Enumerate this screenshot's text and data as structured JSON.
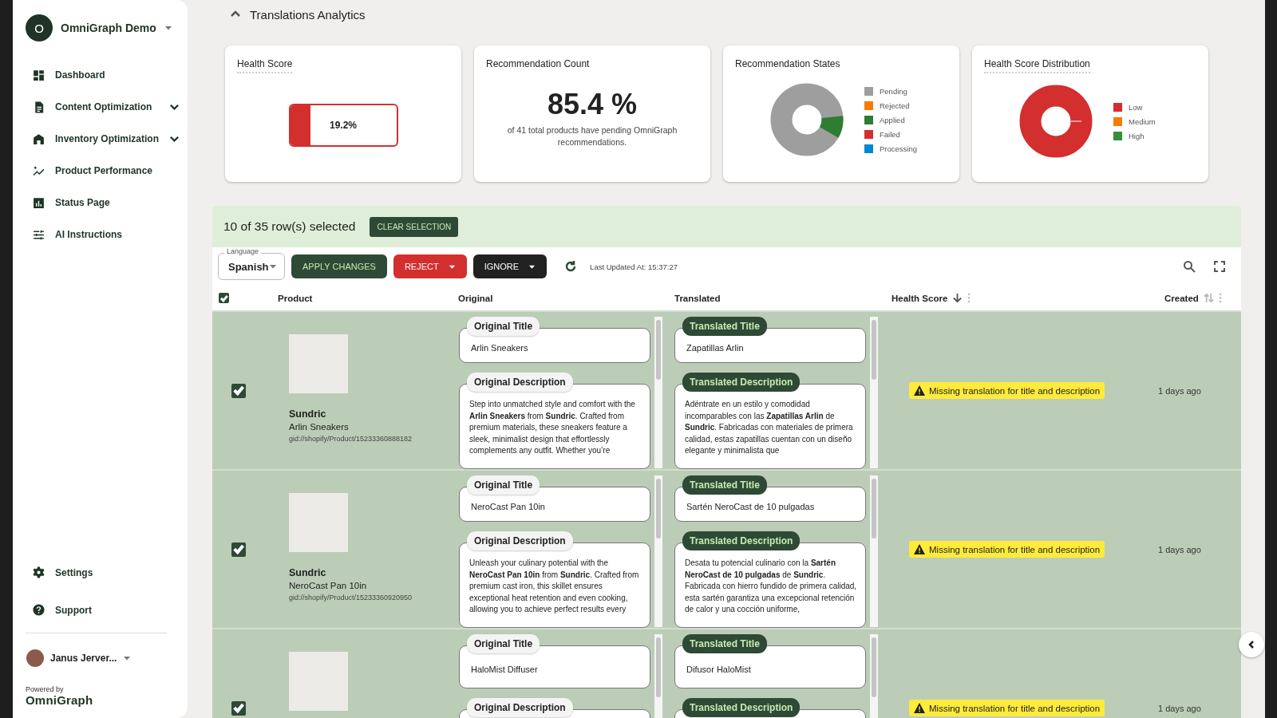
{
  "sidebar": {
    "org": {
      "initial": "O",
      "name": "OmniGraph Demo"
    },
    "nav": [
      {
        "label": "Dashboard",
        "kind": "link"
      },
      {
        "label": "Content Optimization",
        "kind": "group",
        "expanded": false
      },
      {
        "label": "Inventory Optimization",
        "kind": "group",
        "expanded": false
      },
      {
        "label": "Product Performance",
        "kind": "link"
      },
      {
        "label": "Status Page",
        "kind": "link"
      },
      {
        "label": "AI Instructions",
        "kind": "link"
      }
    ],
    "footer_nav": [
      {
        "label": "Settings"
      },
      {
        "label": "Support"
      }
    ],
    "user": {
      "name": "Janus Jerver..."
    },
    "powered_by": "Powered by",
    "brand": "OmniGraph"
  },
  "section": {
    "title": "Translations Analytics",
    "expanded": true
  },
  "cards": [
    {
      "kind": "gauge",
      "title": "Health Score",
      "level": 0.192,
      "reading": "19.2%"
    },
    {
      "kind": "stat",
      "title": "Recommendation Count",
      "value": "85.4 %",
      "caption": "of 41 total products have pending OmniGraph recommendations."
    },
    {
      "kind": "donut",
      "title": "Recommendation States",
      "legend": [
        {
          "label": "Pending",
          "color": "#9e9e9e"
        },
        {
          "label": "Rejected",
          "color": "#f57c00"
        },
        {
          "label": "Applied",
          "color": "#2e7d32"
        },
        {
          "label": "Failed",
          "color": "#d32f2f"
        },
        {
          "label": "Processing",
          "color": "#0288d1"
        }
      ]
    },
    {
      "kind": "donut",
      "title": "Health Score Distribution",
      "legend": [
        {
          "label": "Low",
          "color": "#d32f2f"
        },
        {
          "label": "Medium",
          "color": "#f57c00"
        },
        {
          "label": "High",
          "color": "#388e3c"
        }
      ]
    }
  ],
  "selection": {
    "text": "10 of 35 row(s) selected",
    "clear": "CLEAR SELECTION"
  },
  "toolbar": {
    "language": {
      "label": "Language",
      "value": "Spanish"
    },
    "buttons": [
      {
        "kind": "apply",
        "label": "APPLY CHANGES",
        "menu": false
      },
      {
        "kind": "reject",
        "label": "REJECT",
        "menu": true
      },
      {
        "kind": "ignore",
        "label": "IGNORE",
        "menu": true
      }
    ],
    "last_updated": "Last Updated At: 15:37:27"
  },
  "table": {
    "all_checked": true,
    "columns": [
      {
        "label": "Product"
      },
      {
        "label": "Original"
      },
      {
        "label": "Translated"
      },
      {
        "label": "Health Score",
        "sorted": true,
        "menu": true
      },
      {
        "label": "Created",
        "sorted": false,
        "menu": true
      }
    ],
    "rows": [
      {
        "checked": true,
        "brand": "Sundric",
        "name": "Arlin Sneakers",
        "gid": "gid://shopify/Product/15233360888182",
        "original": {
          "title_label": "Original Title",
          "title": "Arlin Sneakers",
          "description_label": "Original Description",
          "description": "Step into unmatched style and comfort with the **Arlin Sneakers** from **Sundric**. Crafted from premium materials, these sneakers feature a sleek, minimalist design that effortlessly complements any outfit. Whether you’re"
        },
        "translated": {
          "title_label": "Translated Title",
          "title": "Zapatillas Arlin",
          "description_label": "Translated Description",
          "description": "Adéntrate en un estilo y comodidad incomparables con las **Zapatillas Arlin** de **Sundric**. Fabricadas con materiales de primera calidad, estas zapatillas cuentan con un diseño elegante y minimalista que"
        },
        "issue": "Missing translation for title and description",
        "created": "1 days ago"
      },
      {
        "checked": true,
        "brand": "Sundric",
        "name": "NeroCast Pan 10in",
        "gid": "gid://shopify/Product/15233360920950",
        "original": {
          "title_label": "Original Title",
          "title": "NeroCast Pan 10in",
          "description_label": "Original Description",
          "description": "Unleash your culinary potential with the **NeroCast Pan 10in** from **Sundric**. Crafted from premium cast iron, this skillet ensures exceptional heat retention and even cooking, allowing you to achieve perfect results every"
        },
        "translated": {
          "title_label": "Translated Title",
          "title": "Sartén NeroCast de 10 pulgadas",
          "description_label": "Translated Description",
          "description": "Desata tu potencial culinario con la **Sartén NeroCast de 10 pulgadas** de **Sundric**. Fabricada con hierro fundido de primera calidad, esta sartén garantiza una excepcional retención de calor y una cocción uniforme,"
        },
        "issue": "Missing translation for title and description",
        "created": "1 days ago"
      },
      {
        "checked": true,
        "original": {
          "title_label": "Original Title",
          "title": "HaloMist Diffuser",
          "description_label": "Original Description"
        },
        "translated": {
          "title_label": "Translated Title",
          "title": "Difusor HaloMist",
          "description_label": "Translated Description"
        },
        "issue": "Missing translation for title and description",
        "created": "1 days ago"
      }
    ]
  }
}
